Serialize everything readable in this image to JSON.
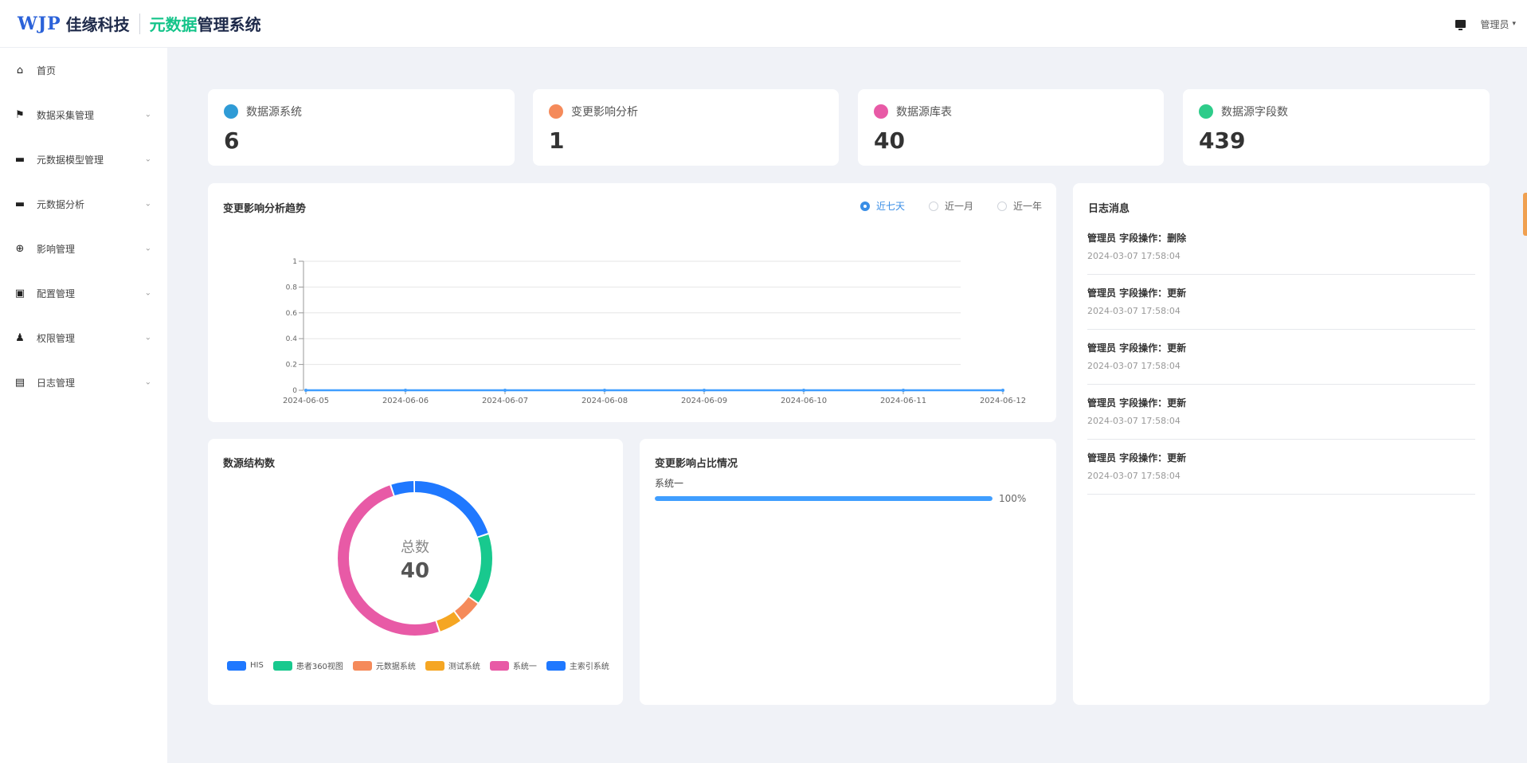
{
  "header": {
    "logo_brand": "WJP",
    "logo_company": "佳缘科技",
    "system_title_accent": "元数据",
    "system_title_rest": "管理系统",
    "user_name": "管理员"
  },
  "sidebar": {
    "items": [
      {
        "label": "首页",
        "icon": "home-icon",
        "glyph": "⌂",
        "expandable": false
      },
      {
        "label": "数据采集管理",
        "icon": "flag-icon",
        "glyph": "⚑",
        "expandable": true
      },
      {
        "label": "元数据模型管理",
        "icon": "monitor-icon",
        "glyph": "▬",
        "expandable": true
      },
      {
        "label": "元数据分析",
        "icon": "monitor-icon",
        "glyph": "▬",
        "expandable": true
      },
      {
        "label": "影响管理",
        "icon": "target-icon",
        "glyph": "⊕",
        "expandable": true
      },
      {
        "label": "配置管理",
        "icon": "settings-icon",
        "glyph": "▣",
        "expandable": true
      },
      {
        "label": "权限管理",
        "icon": "user-icon",
        "glyph": "♟",
        "expandable": true
      },
      {
        "label": "日志管理",
        "icon": "log-icon",
        "glyph": "▤",
        "expandable": true
      }
    ]
  },
  "stats": [
    {
      "label": "数据源系统",
      "value": "6",
      "color": "#2f9bd6"
    },
    {
      "label": "变更影响分析",
      "value": "1",
      "color": "#f58a5a"
    },
    {
      "label": "数据源库表",
      "value": "40",
      "color": "#e85aa6"
    },
    {
      "label": "数据源字段数",
      "value": "439",
      "color": "#2ecc8a"
    }
  ],
  "trend": {
    "title": "变更影响分析趋势",
    "ranges": [
      {
        "label": "近七天",
        "active": true
      },
      {
        "label": "近一月",
        "active": false
      },
      {
        "label": "近一年",
        "active": false
      }
    ]
  },
  "chart_data": [
    {
      "type": "line",
      "title": "变更影响分析趋势",
      "x": [
        "2024-06-05",
        "2024-06-06",
        "2024-06-07",
        "2024-06-08",
        "2024-06-09",
        "2024-06-10",
        "2024-06-11",
        "2024-06-12"
      ],
      "yticks": [
        "0",
        "0.2",
        "0.4",
        "0.6",
        "0.8",
        "1"
      ],
      "ylim": [
        0,
        1
      ],
      "series": [
        {
          "values": [
            0,
            0,
            0,
            0,
            0,
            0,
            0,
            0
          ],
          "color": "#409eff"
        }
      ],
      "grid": true
    },
    {
      "type": "pie",
      "title": "数源结构数",
      "center_label": "总数",
      "center_value": "40",
      "labels": [
        "HIS",
        "患者360视图",
        "元数据系统",
        "测试系统",
        "系统一",
        "主索引系统"
      ],
      "values": [
        8,
        6,
        2,
        2,
        20,
        2
      ],
      "colors": [
        "#1f78ff",
        "#18c98e",
        "#f58a5a",
        "#f5a623",
        "#e85aa6",
        "#1f78ff"
      ],
      "legend": "bottom"
    },
    {
      "type": "bar",
      "title": "变更影响占比情况",
      "categories": [
        "系统一"
      ],
      "values": [
        100
      ],
      "value_labels": [
        "100%"
      ]
    }
  ],
  "logs": {
    "title": "日志消息",
    "items": [
      {
        "text": "管理员 字段操作：删除",
        "time": "2024-03-07 17:58:04"
      },
      {
        "text": "管理员 字段操作：更新",
        "time": "2024-03-07 17:58:04"
      },
      {
        "text": "管理员 字段操作：更新",
        "time": "2024-03-07 17:58:04"
      },
      {
        "text": "管理员 字段操作：更新",
        "time": "2024-03-07 17:58:04"
      },
      {
        "text": "管理员 字段操作：更新",
        "time": "2024-03-07 17:58:04"
      }
    ]
  }
}
